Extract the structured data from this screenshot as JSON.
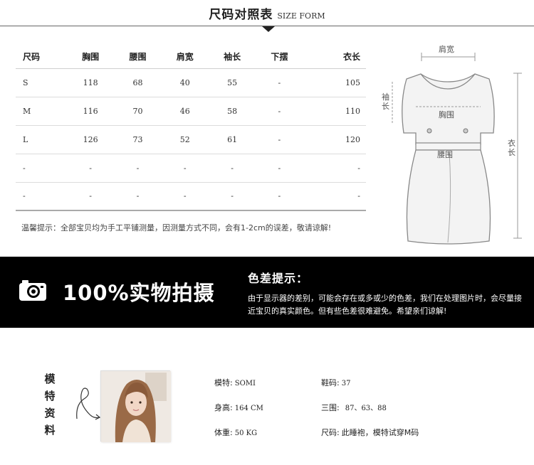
{
  "header": {
    "title_cn": "尺码对照表",
    "title_en": "SIZE FORM"
  },
  "size_table": {
    "columns": [
      "尺码",
      "胸围",
      "腰围",
      "肩宽",
      "袖长",
      "下摆",
      "衣长"
    ],
    "rows": [
      [
        "S",
        "118",
        "68",
        "40",
        "55",
        "-",
        "105"
      ],
      [
        "M",
        "116",
        "70",
        "46",
        "58",
        "-",
        "110"
      ],
      [
        "L",
        "126",
        "73",
        "52",
        "61",
        "-",
        "120"
      ],
      [
        "-",
        "-",
        "-",
        "-",
        "-",
        "-",
        "-"
      ],
      [
        "-",
        "-",
        "-",
        "-",
        "-",
        "-",
        "-"
      ]
    ]
  },
  "size_tip": "温馨提示：全部宝贝均为手工平铺测量，因测量方式不同，会有1-2cm的误差，敬请谅解!",
  "garment": {
    "shoulder": "肩宽",
    "sleeve": "袖长",
    "bust": "胸围",
    "waist": "腰围",
    "length": "衣长"
  },
  "banner": {
    "slogan": "100%实物拍摄",
    "notice_title": "色差提示：",
    "notice_body": "由于显示器的差别，可能会存在或多或少的色差，我们在处理图片时，会尽量接近宝贝的真实颜色。但有些色差很难避免。希望亲们谅解!"
  },
  "model": {
    "title": [
      "模",
      "特",
      "资",
      "料"
    ],
    "name_label": "模特:",
    "name_value": "SOMI",
    "height_label": "身高:",
    "height_value": "164 CM",
    "weight_label": "体重:",
    "weight_value": "50 KG",
    "shoe_label": "鞋码:",
    "shoe_value": "37",
    "measure_label": "三围:",
    "measure_value": "87、63、88",
    "size_label": "尺码:",
    "size_value": "此睡袍，模特试穿M码"
  },
  "colors": {
    "banner_bg": "#000000",
    "banner_text": "#ffffff",
    "table_rule": "#dcdcdc"
  },
  "icons": {
    "banner": "camera-icon"
  }
}
